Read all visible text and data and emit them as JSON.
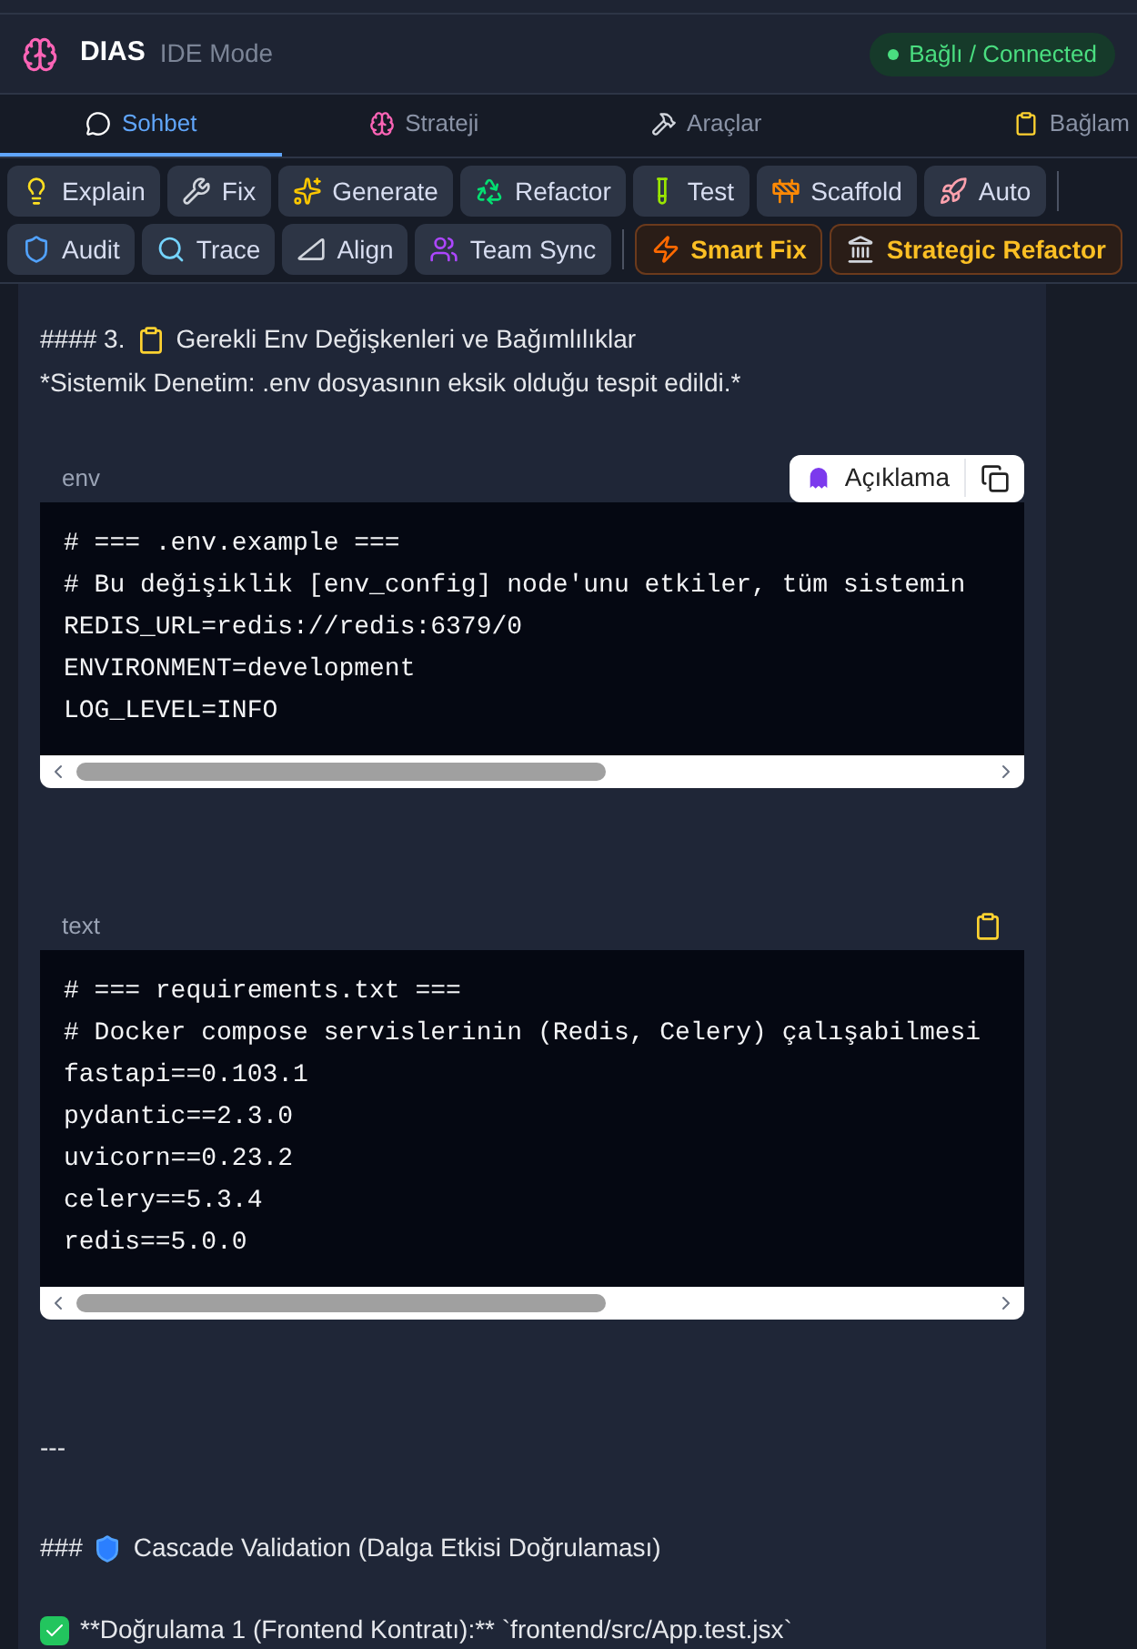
{
  "header": {
    "title": "DIAS",
    "mode": "IDE Mode",
    "status": {
      "label": "Bağlı / Connected",
      "connected": true
    }
  },
  "tabs": [
    {
      "label": "Sohbet",
      "selected": true
    },
    {
      "label": "Strateji",
      "selected": false
    },
    {
      "label": "Araçlar",
      "selected": false
    },
    {
      "label": "Bağlam",
      "selected": false
    }
  ],
  "toolbar": {
    "rows": [
      [
        [
          {
            "label": "Explain",
            "kind": "tool"
          },
          {
            "label": "Fix",
            "kind": "tool"
          },
          {
            "label": "Generate",
            "kind": "tool"
          },
          {
            "label": "Refactor",
            "kind": "tool"
          },
          {
            "label": "Test",
            "kind": "tool"
          },
          {
            "label": "Scaffold",
            "kind": "tool"
          },
          {
            "label": "Auto",
            "kind": "tool"
          }
        ]
      ],
      [
        [
          {
            "label": "Audit",
            "kind": "tool"
          },
          {
            "label": "Trace",
            "kind": "tool"
          },
          {
            "label": "Align",
            "kind": "tool"
          },
          {
            "label": "Team Sync",
            "kind": "tool"
          }
        ],
        [
          {
            "label": "Smart Fix",
            "kind": "highlight"
          },
          {
            "label": "Strategic Refactor",
            "kind": "highlight"
          }
        ]
      ]
    ]
  },
  "content": [
    {
      "kind": "heading",
      "prefix": "#### 3.",
      "text": "Gerekli Env Değişkenleri ve Bağımlılıklar"
    },
    {
      "kind": "paragraph",
      "text": "*Sistemik Denetim: .env dosyasının eksik olduğu tespit edildi.*"
    },
    {
      "kind": "code",
      "language": "env",
      "explain_label": "Açıklama",
      "lines": [
        "# === .env.example ===",
        "# Bu değişiklik [env_config] node'unu etkiler, tüm sistemin",
        "REDIS_URL=redis://redis:6379/0",
        "ENVIRONMENT=development",
        "LOG_LEVEL=INFO"
      ]
    },
    {
      "kind": "code",
      "language": "text",
      "lines": [
        "# === requirements.txt ===",
        "# Docker compose servislerinin (Redis, Celery) çalışabilmesi",
        "fastapi==0.103.1",
        "pydantic==2.3.0",
        "uvicorn==0.23.2",
        "celery==5.3.4",
        "redis==5.0.0"
      ]
    },
    {
      "kind": "rule",
      "text": "---"
    },
    {
      "kind": "heading",
      "prefix": "###",
      "text": "Cascade Validation (Dalga Etkisi Doğrulaması)"
    },
    {
      "kind": "check",
      "text": "**Doğrulama 1 (Frontend Kontratı):** `frontend/src/App.test.jsx`"
    }
  ]
}
